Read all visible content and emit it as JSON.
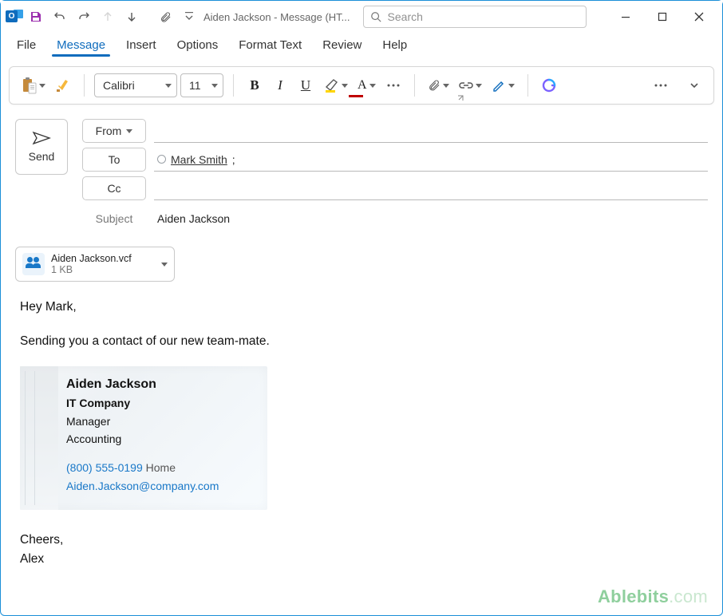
{
  "window": {
    "title": "Aiden Jackson  -  Message (HT...",
    "search_placeholder": "Search"
  },
  "menu": {
    "items": [
      "File",
      "Message",
      "Insert",
      "Options",
      "Format Text",
      "Review",
      "Help"
    ],
    "active_index": 1
  },
  "ribbon": {
    "font_name": "Calibri",
    "font_size": "11"
  },
  "compose": {
    "send_label": "Send",
    "from_label": "From",
    "to_label": "To",
    "cc_label": "Cc",
    "subject_label": "Subject",
    "to_recipient": "Mark Smith",
    "subject_value": "Aiden Jackson"
  },
  "attachment": {
    "name": "Aiden Jackson.vcf",
    "size": "1 KB"
  },
  "body": {
    "greeting": "Hey Mark,",
    "line1": "Sending you a contact of our new team-mate.",
    "closing1": "Cheers,",
    "closing2": "Alex"
  },
  "card": {
    "name": "Aiden Jackson",
    "company": "IT Company",
    "role": "Manager",
    "dept": "Accounting",
    "phone": "(800) 555-0199",
    "phone_label": "Home",
    "email": "Aiden.Jackson@company.com"
  },
  "watermark": {
    "brand": "Ablebits",
    "suffix": ".com"
  }
}
